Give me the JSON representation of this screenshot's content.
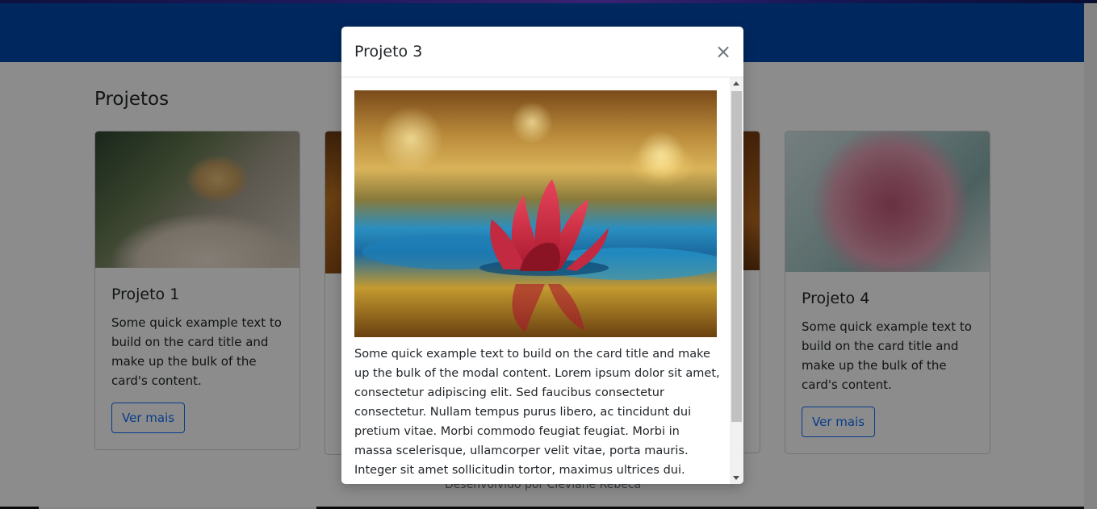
{
  "page": {
    "section_title": "Projetos",
    "footer_text": "Desenvolvido por Cleviane Rebeca"
  },
  "cards": [
    {
      "title": "Projeto 1",
      "text": "Some quick example text to build on the card title and make up the bulk of the card's content.",
      "button": "Ver mais",
      "image": "lizard"
    },
    {
      "title": "Projeto 4",
      "text": "Some quick example text to build on the card title and make up the bulk of the card's content.",
      "button": "Ver mais",
      "image": "pink-rose"
    }
  ],
  "modal": {
    "title": "Projeto 3",
    "close_symbol": "×",
    "image": "red-water-lily",
    "body_text": "Some quick example text to build on the card title and make up the bulk of the modal content. Lorem ipsum dolor sit amet, consectetur adipiscing elit. Sed faucibus consectetur consectetur. Nullam tempus purus libero, ac tincidunt dui pretium vitae. Morbi commodo feugiat feugiat. Morbi in massa scelerisque, ullamcorper velit vitae, porta mauris. Integer sit amet sollicitudin tortor, maximus ultrices dui. Vestibulum sem"
  },
  "colors": {
    "header": "#004aad",
    "button_accent": "#0d6efd",
    "lily_red": "#c8243c",
    "rose_pink": "#d47a95"
  }
}
